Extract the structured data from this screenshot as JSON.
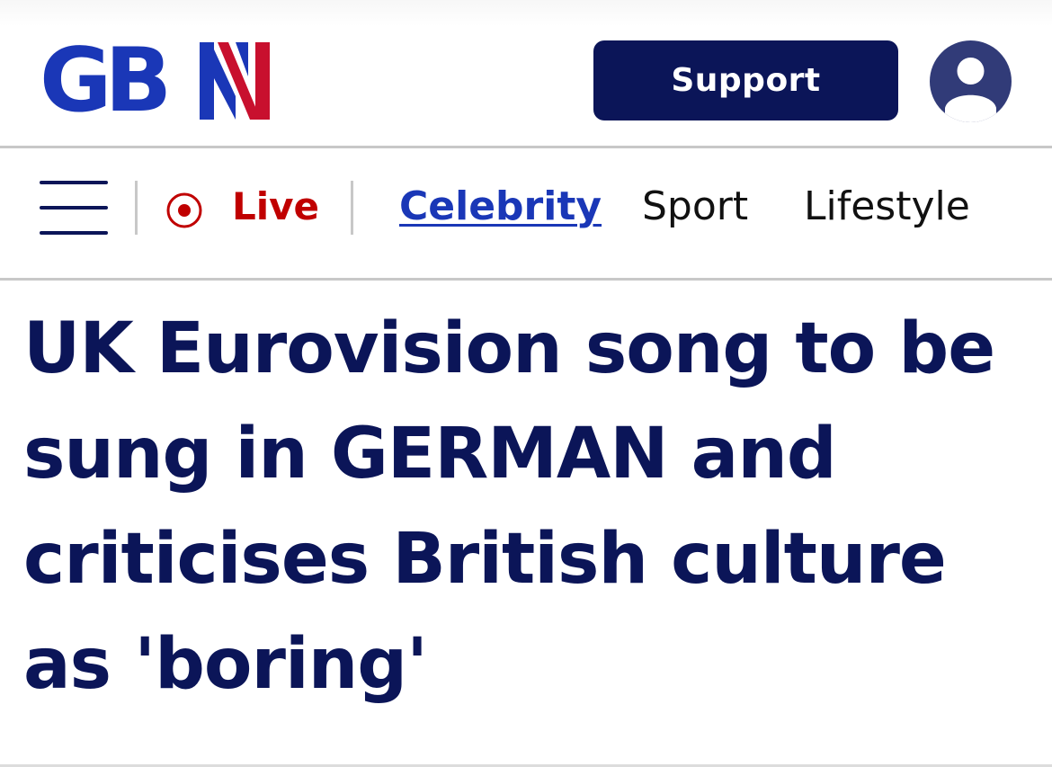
{
  "header": {
    "logo_text": "GBN",
    "support_label": "Support",
    "avatar_icon": "user-icon"
  },
  "nav": {
    "menu_icon": "hamburger-menu-icon",
    "live_icon": "live-record-icon",
    "live_label": "Live",
    "items": [
      {
        "label": "Celebrity",
        "active": true
      },
      {
        "label": "Sport",
        "active": false
      },
      {
        "label": "Lifestyle",
        "active": false
      }
    ]
  },
  "article": {
    "headline": "UK Eurovision song to be sung in GERMAN and criticises British culture as 'boring'"
  },
  "colors": {
    "brand_navy": "#0b1558",
    "brand_blue": "#1a37b7",
    "live_red": "#c00000",
    "avatar_bg": "#313b78"
  }
}
